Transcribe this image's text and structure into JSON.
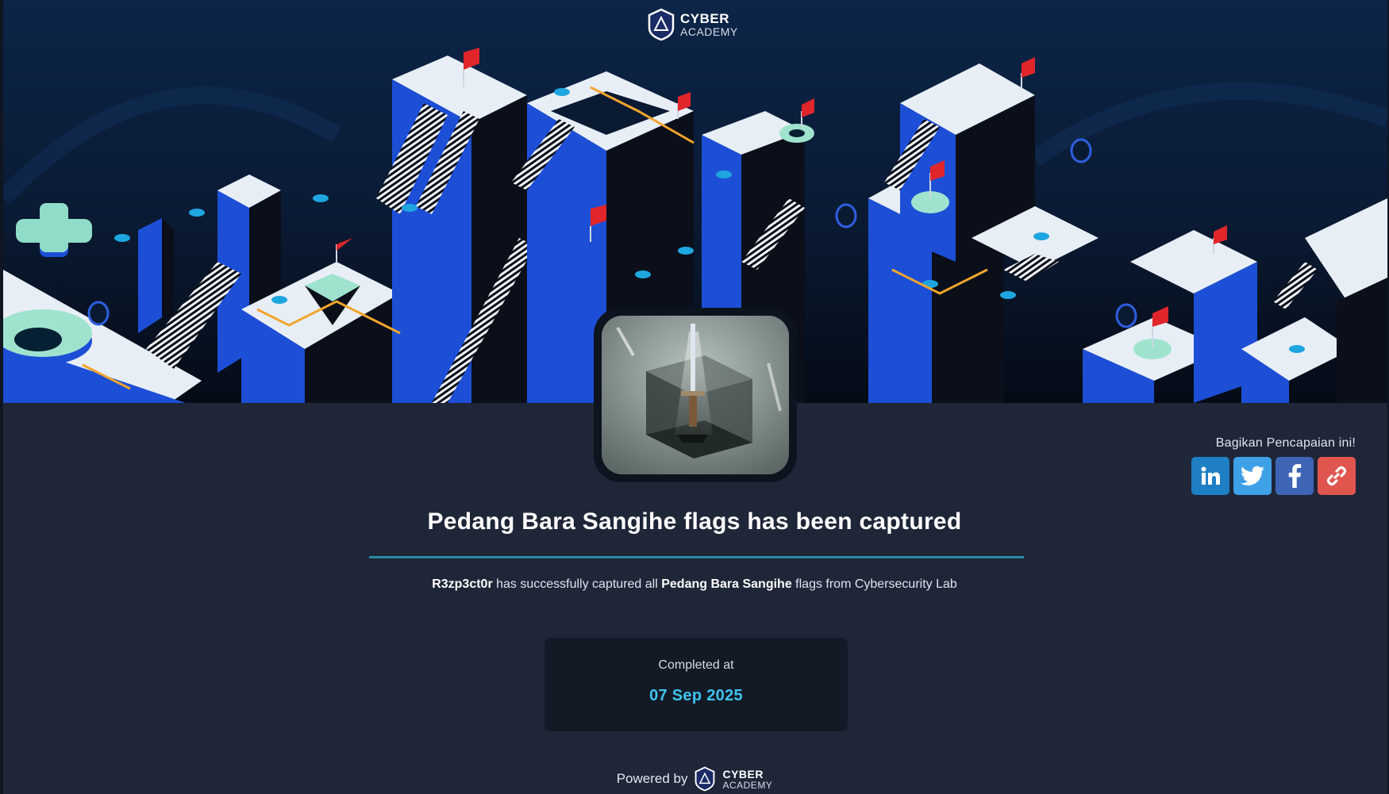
{
  "brand": {
    "name_line1": "CYBER",
    "name_line2": "ACADEMY"
  },
  "banner": {
    "scene": "isometric-castle-illustration"
  },
  "badge": {
    "image": "sword-in-glass-cube-badge-image"
  },
  "share": {
    "label": "Bagikan Pencapaian ini!",
    "buttons": [
      {
        "icon": "linkedin-icon",
        "color": "#1f7fc4"
      },
      {
        "icon": "twitter-icon",
        "color": "#3ea0e6"
      },
      {
        "icon": "facebook-icon",
        "color": "#3e64b6"
      },
      {
        "icon": "link-icon",
        "color": "#e0564e"
      }
    ]
  },
  "achievement": {
    "title": "Pedang Bara Sangihe flags has been captured",
    "username": "R3zp3ct0r",
    "desc_part1": " has successfully captured all ",
    "challenge": "Pedang Bara Sangihe",
    "desc_part2": " flags from Cybersecurity Lab"
  },
  "completed": {
    "label": "Completed at",
    "date": "07 Sep 2025"
  },
  "footer": {
    "powered_by": "Powered by"
  },
  "colors": {
    "accent": "#3fc3ef",
    "background": "#1e2638",
    "divider": "#2a8aa6"
  }
}
